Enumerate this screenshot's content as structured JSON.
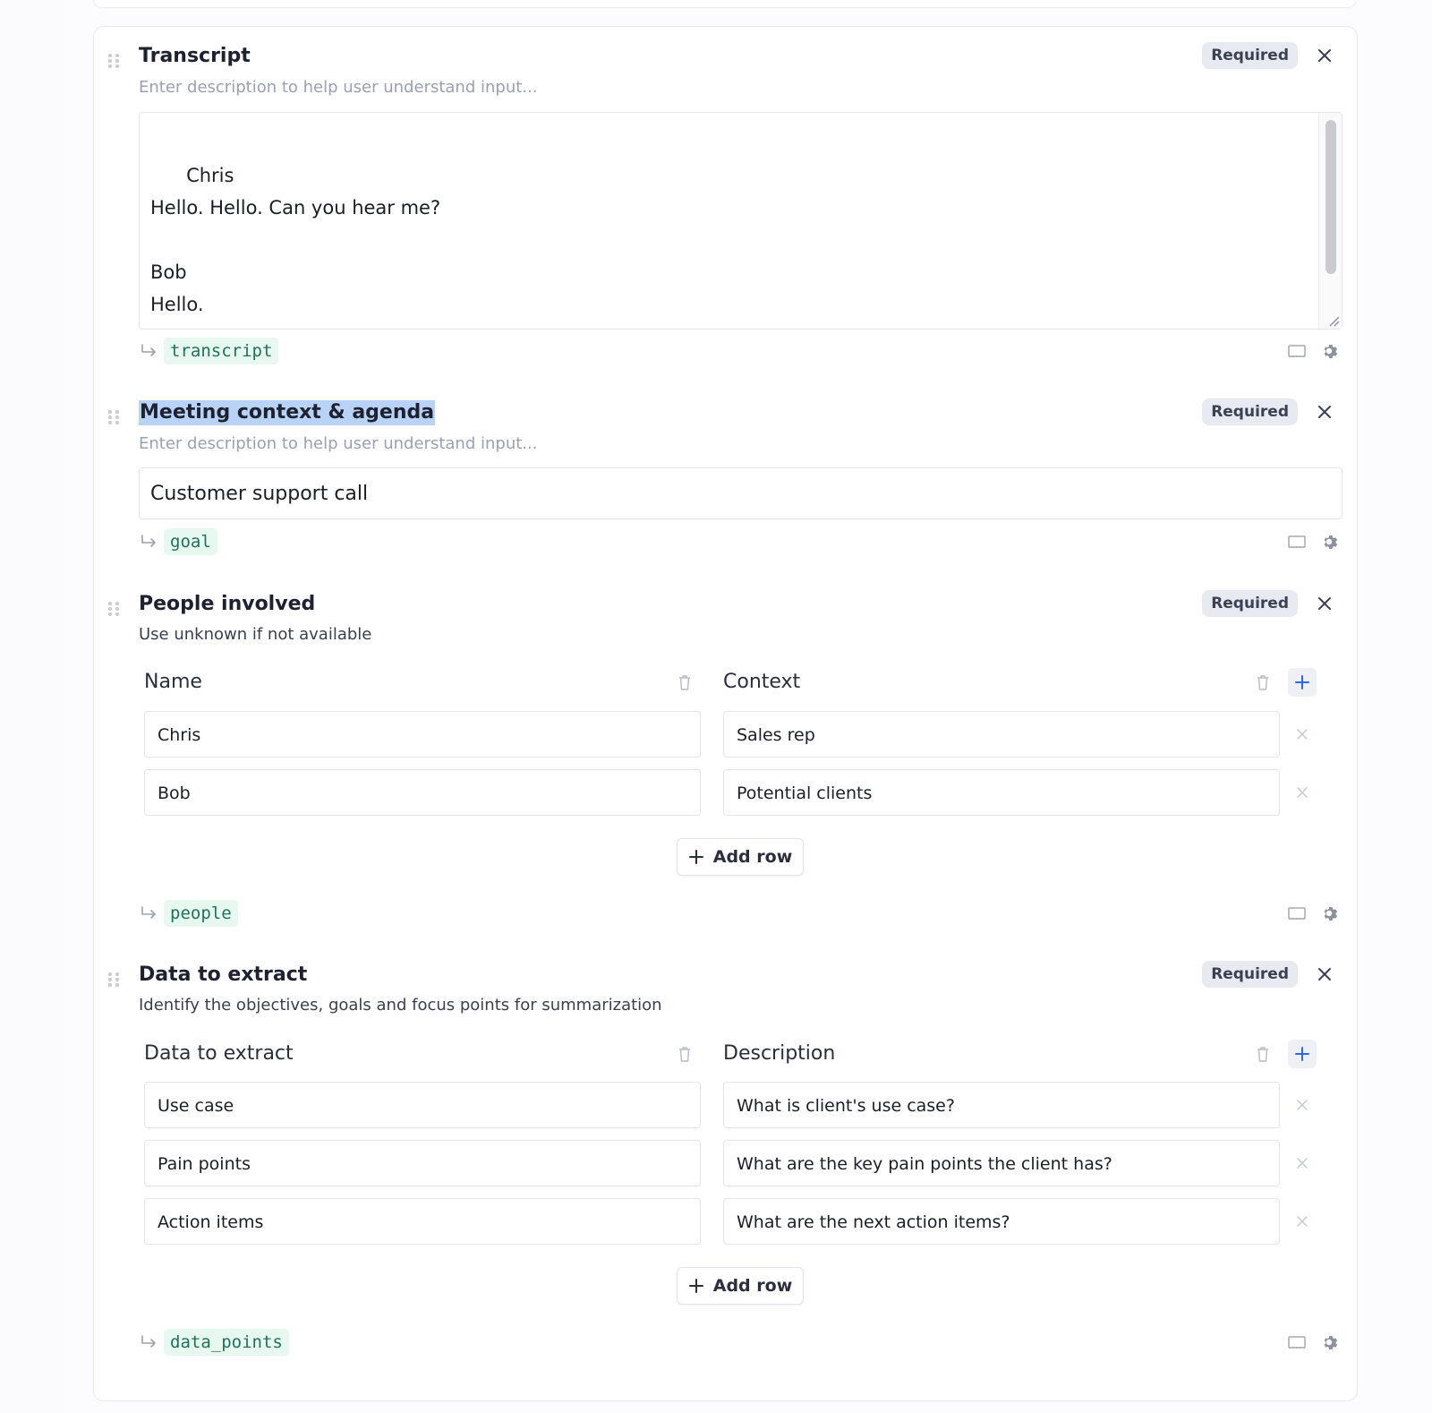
{
  "sections": [
    {
      "title": "Transcript",
      "description": "Enter description to help user understand input...",
      "badge": "Required",
      "value": "Chris\nHello. Hello. Can you hear me?\n\nBob\nHello.",
      "variable": "transcript"
    },
    {
      "title": "Meeting context & agenda",
      "description": "Enter description to help user understand input...",
      "badge": "Required",
      "value": "Customer support call",
      "variable": "goal"
    },
    {
      "title": "People involved",
      "description": "Use unknown if not available",
      "badge": "Required",
      "columns": [
        "Name",
        "Context"
      ],
      "rows": [
        [
          "Chris",
          "Sales rep"
        ],
        [
          "Bob",
          "Potential clients"
        ]
      ],
      "add_row_label": "Add row",
      "variable": "people"
    },
    {
      "title": "Data to extract",
      "description": "Identify the objectives, goals and focus points for summarization",
      "badge": "Required",
      "columns": [
        "Data to extract",
        "Description"
      ],
      "rows": [
        [
          "Use case",
          "What is client's use case?"
        ],
        [
          "Pain points",
          "What are the key pain points the client has?"
        ],
        [
          "Action items",
          "What are the next action items?"
        ]
      ],
      "add_row_label": "Add row",
      "variable": "data_points"
    }
  ],
  "icons": {
    "drag": "drag-handle-icon",
    "close": "close-icon",
    "variable": "return-arrow-icon",
    "expand": "expand-icon",
    "settings": "gear-icon",
    "delete": "trash-icon",
    "add": "plus-icon",
    "remove": "x-icon"
  },
  "colors": {
    "accent": "#2f6bd8",
    "badge_bg": "#e8eaf1",
    "chip_bg": "#e6f8ef",
    "chip_text": "#22715a",
    "highlight": "#b9d3f7"
  }
}
